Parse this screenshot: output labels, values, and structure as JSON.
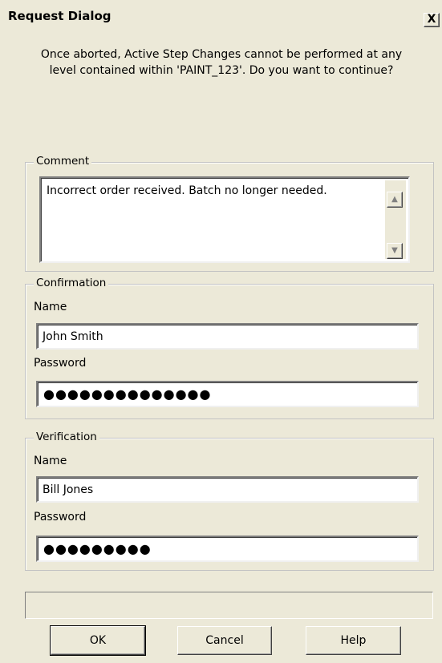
{
  "dialog": {
    "title": "Request Dialog",
    "close_label": "X",
    "message_line1": "Once aborted, Active Step Changes cannot be performed at any",
    "message_line2": "level contained within 'PAINT_123'.  Do you want to continue?"
  },
  "comment": {
    "legend": "Comment",
    "value": "Incorrect order received.  Batch no longer needed."
  },
  "confirmation": {
    "legend": "Confirmation",
    "name_label": "Name",
    "name_value": "John Smith",
    "password_label": "Password",
    "password_mask": "●●●●●●●●●●●●●●"
  },
  "verification": {
    "legend": "Verification",
    "name_label": "Name",
    "name_value": "Bill Jones",
    "password_label": "Password",
    "password_mask": "●●●●●●●●●"
  },
  "buttons": {
    "ok": "OK",
    "cancel": "Cancel",
    "help": "Help"
  },
  "icons": {
    "scroll_up": "triangle-up",
    "scroll_down": "triangle-down"
  }
}
